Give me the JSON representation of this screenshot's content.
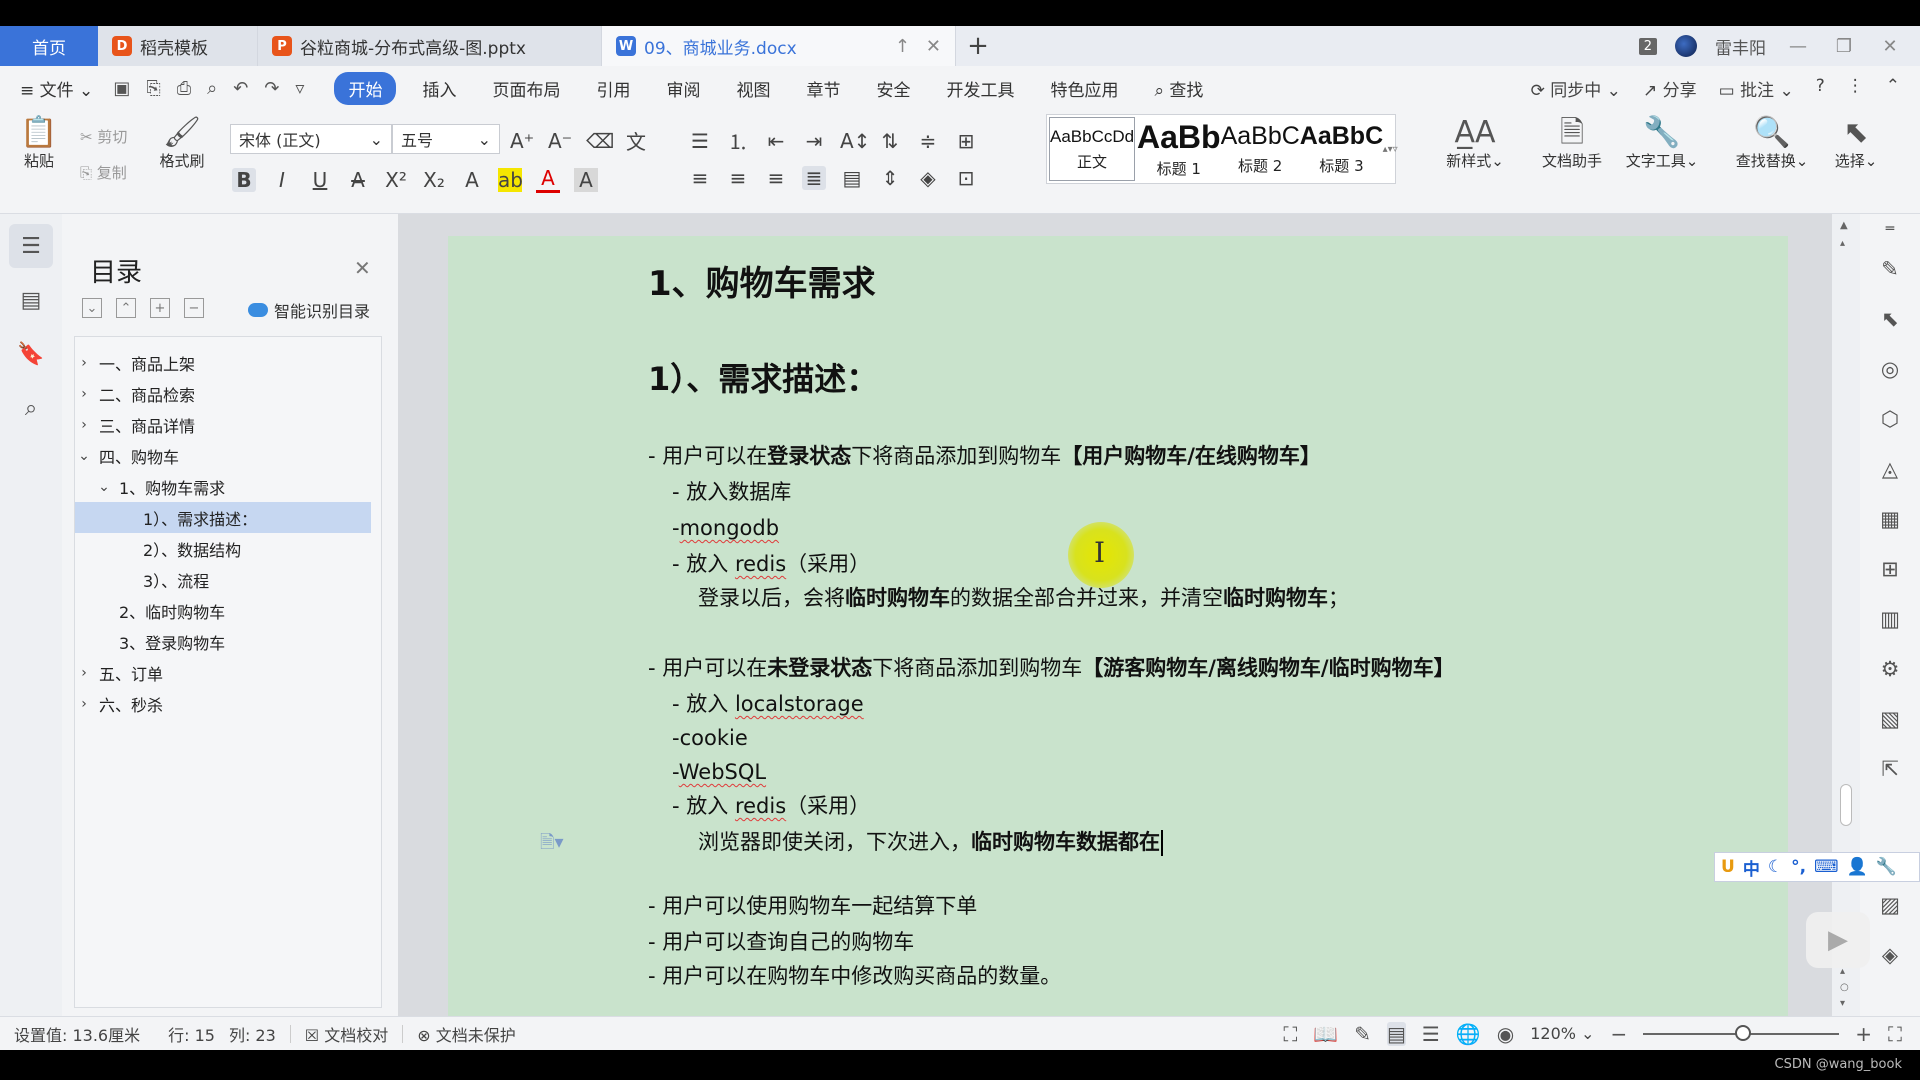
{
  "titlebar": {
    "home_tab": "首页",
    "tabs": [
      {
        "label": "稻壳模板",
        "icon": "daoke-icon",
        "color": "#e8541a"
      },
      {
        "label": "谷粒商城-分布式高级-图.pptx",
        "icon": "ppt-icon",
        "color": "#e8541a"
      },
      {
        "label": "09、商城业务.docx",
        "icon": "word-icon",
        "color": "#3a73d9",
        "active": true
      }
    ],
    "window_count": "2",
    "user_name": "雷丰阳"
  },
  "menu": {
    "file": "文件",
    "items": [
      "开始",
      "插入",
      "页面布局",
      "引用",
      "审阅",
      "视图",
      "章节",
      "安全",
      "开发工具",
      "特色应用"
    ],
    "search": "查找",
    "sync": "同步中",
    "share": "分享",
    "comment": "批注"
  },
  "ribbon": {
    "paste": "粘贴",
    "cut": "剪切",
    "copy": "复制",
    "format_painter": "格式刷",
    "font_name": "宋体 (正文)",
    "font_size": "五号",
    "styles": [
      {
        "sample": "AaBbCcDd",
        "name": "正文"
      },
      {
        "sample": "AaBb",
        "name": "标题 1"
      },
      {
        "sample": "AaBbC",
        "name": "标题 2"
      },
      {
        "sample": "AaBbC",
        "name": "标题 3"
      }
    ],
    "new_style": "新样式",
    "doc_assistant": "文档助手",
    "text_tools": "文字工具",
    "find_replace": "查找替换",
    "select": "选择"
  },
  "toc": {
    "title": "目录",
    "smart": "智能识别目录",
    "items": [
      {
        "label": "一、商品上架",
        "level": 0,
        "chev": "›"
      },
      {
        "label": "二、商品检索",
        "level": 0,
        "chev": "›"
      },
      {
        "label": "三、商品详情",
        "level": 0,
        "chev": "›"
      },
      {
        "label": "四、购物车",
        "level": 0,
        "chev": "⌄"
      },
      {
        "label": "1、购物车需求",
        "level": 1,
        "chev": "⌄"
      },
      {
        "label": "1）、需求描述：",
        "level": 2,
        "chev": "",
        "selected": true
      },
      {
        "label": "2）、数据结构",
        "level": 2,
        "chev": ""
      },
      {
        "label": "3）、流程",
        "level": 2,
        "chev": ""
      },
      {
        "label": "2、临时购物车",
        "level": 1,
        "chev": ""
      },
      {
        "label": "3、登录购物车",
        "level": 1,
        "chev": ""
      },
      {
        "label": "五、订单",
        "level": 0,
        "chev": "›"
      },
      {
        "label": "六、秒杀",
        "level": 0,
        "chev": "›"
      }
    ]
  },
  "doc": {
    "h1": "1、购物车需求",
    "h2": "1）、需求描述：",
    "l1_pre": "- 用户可以在",
    "l1_b1": "登录状态",
    "l1_mid": "下将商品添加到购物车",
    "l1_b2": "【用户购物车/在线购物车】",
    "l2": "- 放入数据库",
    "l3_dash": "-",
    "l3_word": "mongodb",
    "l4_pre": "- 放入",
    "l4_word": "redis",
    "l4_post": "（采用）",
    "l5_pre": "登录以后，会将",
    "l5_b1": "临时购物车",
    "l5_mid": "的数据全部合并过来，并清空",
    "l5_b2": "临时购物车",
    "l5_post": "；",
    "l6_pre": "- 用户可以在",
    "l6_b1": "未登录状态",
    "l6_mid": "下将商品添加到购物车",
    "l6_b2": "【游客购物车/离线购物车/临时购物车】",
    "l7_pre": "- 放入",
    "l7_word": "localstorage",
    "l8": "-cookie",
    "l9_dash": "-",
    "l9_word": "WebSQL",
    "l10_pre": "- 放入",
    "l10_word": "redis",
    "l10_post": "（采用）",
    "l11_pre": "浏览器即使关闭，下次进入，",
    "l11_b": "临时购物车数据都在",
    "l12": "- 用户可以使用购物车一起结算下单",
    "l13": "- 用户可以查询自己的购物车",
    "l14": "- 用户可以在购物车中修改购买商品的数量。"
  },
  "ime": {
    "lang": "中"
  },
  "status": {
    "setting": "设置值: 13.6厘米",
    "row": "行: 15",
    "col": "列: 23",
    "proof": "文档校对",
    "protect": "文档未保护",
    "zoom": "120%"
  },
  "watermark": "CSDN @wang_book",
  "colors": {
    "accent": "#3a73d9",
    "page": "#c9e3cc",
    "toc_selected": "#c6d7f1"
  }
}
